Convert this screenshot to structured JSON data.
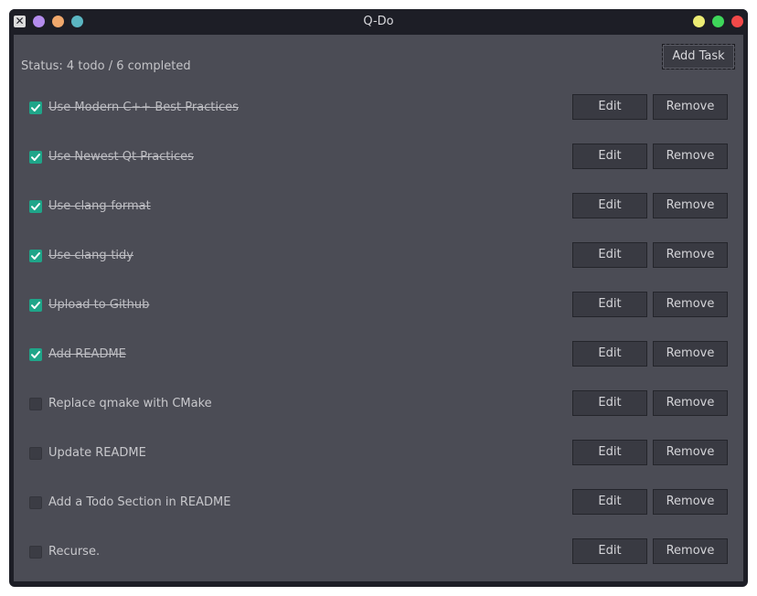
{
  "window": {
    "title": "Q-Do",
    "left_dots": [
      "#b48ced",
      "#f0a86c",
      "#5bb6c2"
    ],
    "right_dots": [
      "#ecec74",
      "#3ed65a",
      "#f24949"
    ]
  },
  "header": {
    "status": "Status: 4 todo / 6 completed",
    "add_task_label": "Add Task"
  },
  "colors": {
    "accent_checked": "#1fa589",
    "background": "#4b4c55"
  },
  "tasks": [
    {
      "label": "Use Modern C++ Best Practices",
      "done": true,
      "edit_label": "Edit",
      "remove_label": "Remove"
    },
    {
      "label": "Use Newest Qt Practices",
      "done": true,
      "edit_label": "Edit",
      "remove_label": "Remove"
    },
    {
      "label": "Use clang-format",
      "done": true,
      "edit_label": "Edit",
      "remove_label": "Remove"
    },
    {
      "label": "Use clang-tidy",
      "done": true,
      "edit_label": "Edit",
      "remove_label": "Remove"
    },
    {
      "label": "Upload to Github",
      "done": true,
      "edit_label": "Edit",
      "remove_label": "Remove"
    },
    {
      "label": "Add README",
      "done": true,
      "edit_label": "Edit",
      "remove_label": "Remove"
    },
    {
      "label": "Replace qmake with CMake",
      "done": false,
      "edit_label": "Edit",
      "remove_label": "Remove"
    },
    {
      "label": "Update README",
      "done": false,
      "edit_label": "Edit",
      "remove_label": "Remove"
    },
    {
      "label": "Add a Todo Section in README",
      "done": false,
      "edit_label": "Edit",
      "remove_label": "Remove"
    },
    {
      "label": "Recurse.",
      "done": false,
      "edit_label": "Edit",
      "remove_label": "Remove"
    }
  ]
}
